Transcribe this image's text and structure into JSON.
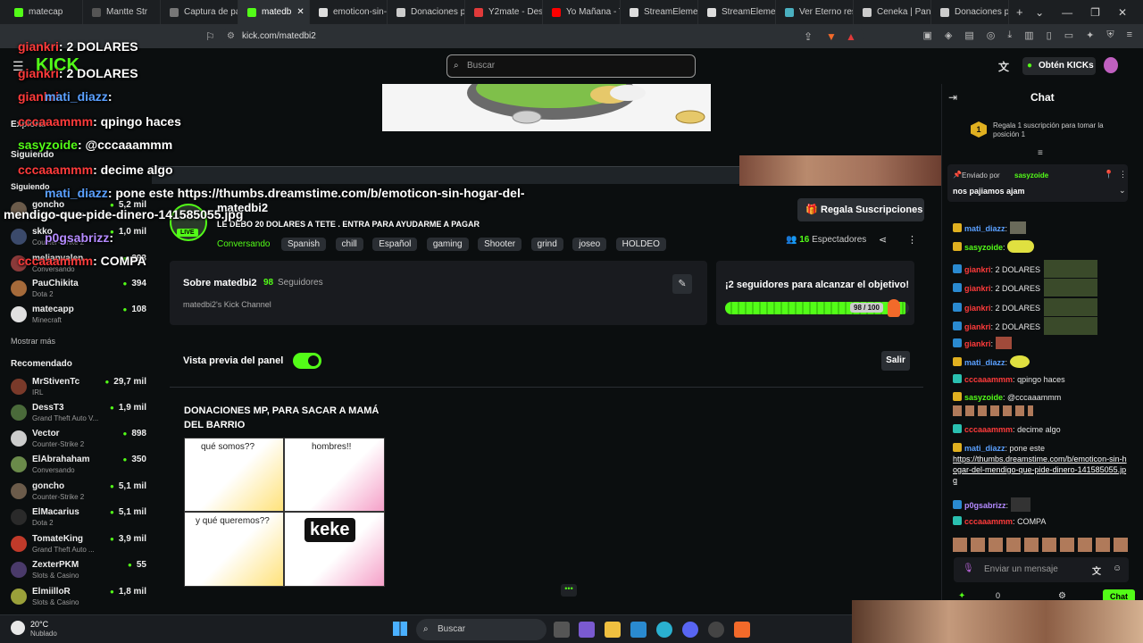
{
  "browser": {
    "tabs": [
      {
        "label": "matecap"
      },
      {
        "label": "Mantte Str"
      },
      {
        "label": "Captura de pan"
      },
      {
        "label": "matedb"
      },
      {
        "label": "emoticon-sin-h"
      },
      {
        "label": "Donaciones pa"
      },
      {
        "label": "Y2mate - Desc"
      },
      {
        "label": "Yo Mañana - Y"
      },
      {
        "label": "StreamElement"
      },
      {
        "label": "StreamElement"
      },
      {
        "label": "Ver Eterno resp"
      },
      {
        "label": "Ceneka | Panel"
      },
      {
        "label": "Donaciones pa"
      }
    ],
    "new_tab": "+",
    "url": "kick.com/matedbi2"
  },
  "header": {
    "search_placeholder": "Buscar",
    "get_kicks": "Obtén KICKs"
  },
  "sidebar": {
    "explore": "Explorar",
    "following": "Siguiendo",
    "following_heading": "Siguiendo",
    "followed": [
      {
        "name": "goncho",
        "sub": "Counter-Strike 2",
        "count": "5,2 mil",
        "color": "#6b5b4a"
      },
      {
        "name": "skko",
        "sub": "Counter-Strike 2",
        "count": "1,0 mil",
        "color": "#3b4a6b"
      },
      {
        "name": "melianvalen",
        "sub": "Conversando",
        "count": "293",
        "color": "#8a3a3a"
      },
      {
        "name": "PauChikita",
        "sub": "Dota 2",
        "count": "394",
        "color": "#a56a3a"
      },
      {
        "name": "matecapp",
        "sub": "Minecraft",
        "count": "108",
        "color": "#e0e0e0"
      }
    ],
    "show_more": "Mostrar más",
    "recommended_heading": "Recomendado",
    "recommended": [
      {
        "name": "MrStivenTc",
        "sub": "IRL",
        "count": "29,7 mil",
        "color": "#7a3a2a"
      },
      {
        "name": "DessT3",
        "sub": "Grand Theft Auto V...",
        "count": "1,9 mil",
        "color": "#4a6a3a"
      },
      {
        "name": "Vector",
        "sub": "Counter-Strike 2",
        "count": "898",
        "color": "#cccccc"
      },
      {
        "name": "ElAbrahaham",
        "sub": "Conversando",
        "count": "350",
        "color": "#6a8a4a"
      },
      {
        "name": "goncho",
        "sub": "Counter-Strike 2",
        "count": "5,1 mil",
        "color": "#6b5b4a"
      },
      {
        "name": "ElMacarius",
        "sub": "Dota 2",
        "count": "5,1 mil",
        "color": "#2a2a2a"
      },
      {
        "name": "TomateKing",
        "sub": "Grand Theft Auto ...",
        "count": "3,9 mil",
        "color": "#c03a2a"
      },
      {
        "name": "ZexterPKM",
        "sub": "Slots & Casino",
        "count": "55",
        "color": "#4a3a6a"
      },
      {
        "name": "ElmiilloR",
        "sub": "Slots & Casino",
        "count": "1,8 mil",
        "color": "#9aa03a"
      }
    ]
  },
  "channel": {
    "live_badge": "LIVE",
    "name": "matedbi2",
    "stream_title": "LE DEBO 20 DOLARES A TETE . ENTRA PARA AYUDARME A PAGAR",
    "category": "Conversando",
    "tags": [
      "Spanish",
      "chill",
      "Español",
      "gaming",
      "Shooter",
      "grind",
      "joseo",
      "HOLDEO"
    ],
    "gift_subs_button": "Regala Suscripciones",
    "viewers_count": "16",
    "viewers_label": "Espectadores",
    "about_label": "Sobre matedbi2",
    "followers_count": "98",
    "followers_label": "Seguidores",
    "bio": "matedbi2's Kick Channel",
    "goal_title": "¡2 seguidores para alcanzar el objetivo!",
    "goal_progress_text": "98 / 100",
    "goal_current": 98,
    "goal_target": 100,
    "panel_preview_label": "Vista previa del panel",
    "exit_button": "Salir",
    "panel_title": "DONACIONES MP, PARA SACAR A MAMÁ DEL BARRIO",
    "meme_texts": [
      "qué somos??",
      "hombres!!",
      "y qué queremos??",
      "keke"
    ]
  },
  "chat": {
    "title": "Chat",
    "sub_promo": "Regala 1 suscripción para tomar la posición 1",
    "pinned_by_label": "Enviado por",
    "pinned_user": "sasyzoide",
    "pinned_text": "nos pajiamos ajam",
    "messages": [
      {
        "user": "mati_diazz",
        "text": "",
        "color": "#5aa0ff"
      },
      {
        "user": "sasyzoide",
        "text": "",
        "color": "#53fc18"
      },
      {
        "user": "giankri",
        "text": "2 DOLARES",
        "color": "#ff3b3b"
      },
      {
        "user": "giankri",
        "text": "2 DOLARES",
        "color": "#ff3b3b"
      },
      {
        "user": "giankri",
        "text": "2 DOLARES",
        "color": "#ff3b3b"
      },
      {
        "user": "giankri",
        "text": "2 DOLARES",
        "color": "#ff3b3b"
      },
      {
        "user": "giankri",
        "text": "",
        "color": "#ff3b3b"
      },
      {
        "user": "mati_diazz",
        "text": "",
        "color": "#5aa0ff"
      },
      {
        "user": "cccaaammm",
        "text": "qpingo haces",
        "color": "#ff3b3b"
      },
      {
        "user": "sasyzoide",
        "text": "@cccaaammm",
        "color": "#53fc18"
      },
      {
        "user": "cccaaammm",
        "text": "decime algo",
        "color": "#ff3b3b"
      },
      {
        "user": "mati_diazz",
        "text": "pone este",
        "color": "#5aa0ff"
      },
      {
        "user": "p0gsabrizz",
        "text": "",
        "color": "#b48aff"
      },
      {
        "user": "cccaaammm",
        "text": "COMPA",
        "color": "#ff3b3b"
      }
    ],
    "link": "https://thumbs.dreamstime.com/b/emoticon-sin-hogar-del-mendigo-que-pide-dinero-141585055.jpg",
    "input_placeholder": "Enviar un mensaje",
    "kicks_count": "0",
    "chat_button": "Chat"
  },
  "overlay": {
    "lines": [
      {
        "user": "giankri",
        "text": ": 2 DOLARES"
      },
      {
        "user": "giankri",
        "text": ": 2 DOLARES"
      },
      {
        "user": "giankri",
        "text": ":"
      },
      {
        "user": "mati_diazz",
        "text": ":"
      },
      {
        "user": "cccaaammm",
        "text": ": qpingo haces"
      },
      {
        "user": "sasyzoide",
        "text": ": @cccaaammm"
      },
      {
        "user": "cccaaammm",
        "text": ": decime algo"
      },
      {
        "user": "mati_diazz",
        "text": ": pone este https://thumbs.dreamstime.com/b/emoticon-sin-hogar-del-"
      },
      {
        "user": "",
        "text": "mendigo-que-pide-dinero-141585055.jpg"
      },
      {
        "user": "p0gsabrizz",
        "text": ":"
      },
      {
        "user": "cccaaammm",
        "text": ": COMPA"
      }
    ]
  },
  "taskbar": {
    "weather_temp": "20°C",
    "weather_desc": "Nublado",
    "search_label": "Buscar"
  }
}
